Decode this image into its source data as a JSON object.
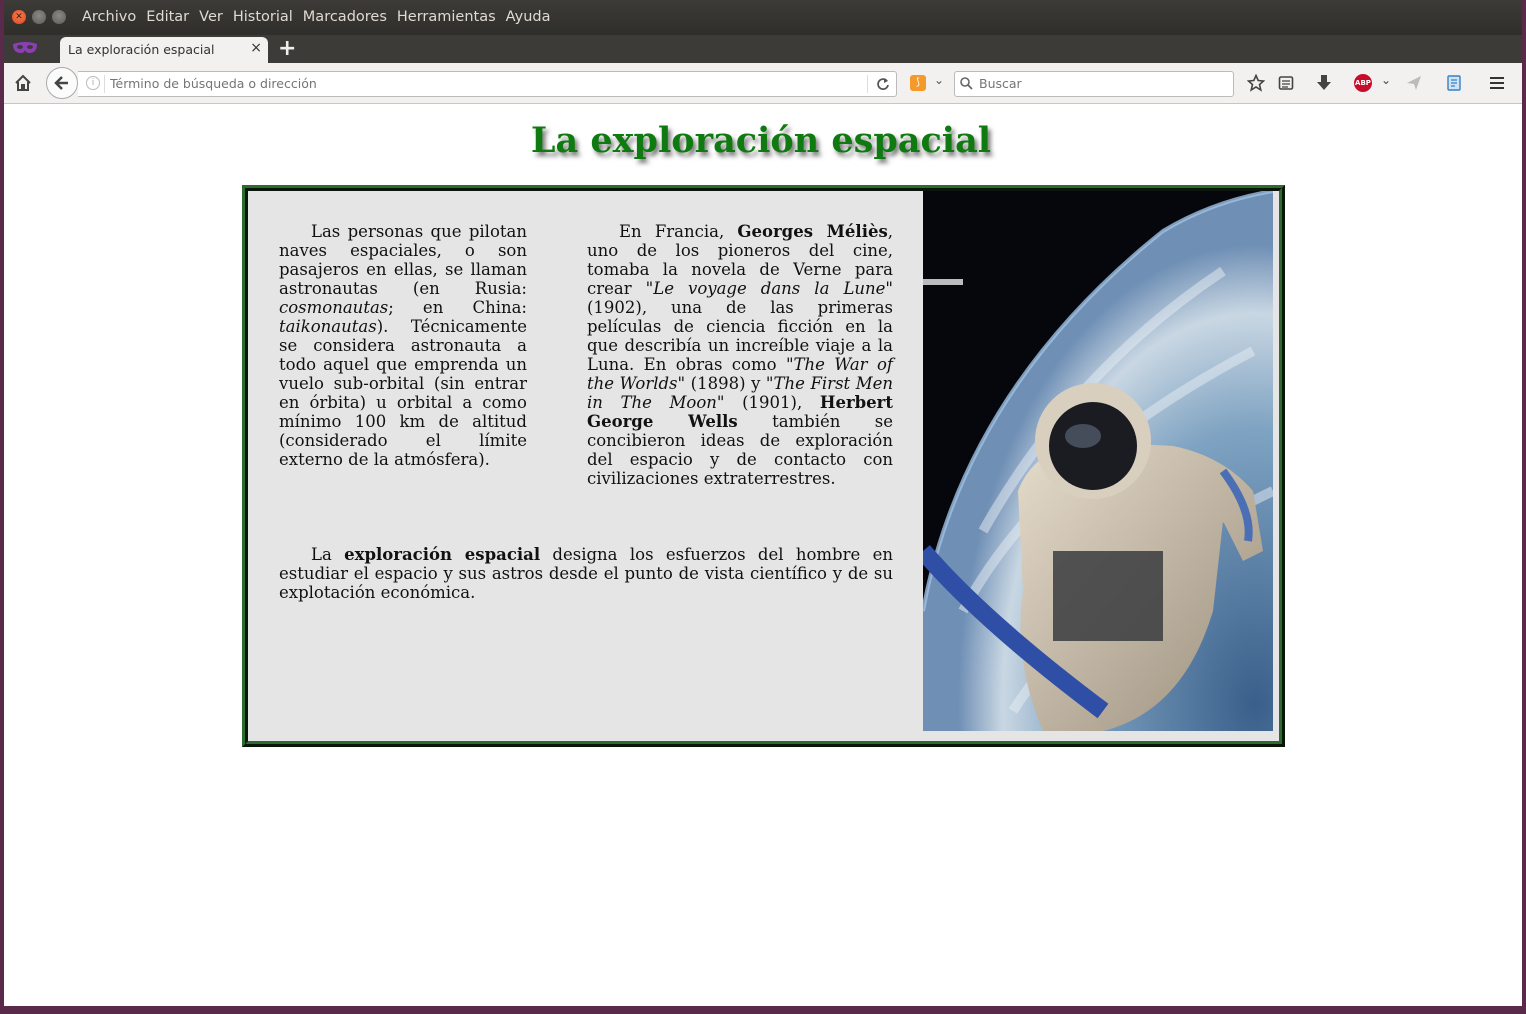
{
  "menubar": {
    "items": [
      "Archivo",
      "Editar",
      "Ver",
      "Historial",
      "Marcadores",
      "Herramientas",
      "Ayuda"
    ]
  },
  "tab": {
    "title": "La exploración espacial",
    "close": "×",
    "new": "+"
  },
  "navbar": {
    "url_placeholder": "Término de búsqueda o dirección",
    "search_placeholder": "Buscar",
    "abp": "ABP"
  },
  "page": {
    "heading": "La exploración espacial",
    "col1": {
      "t1": "Las personas que pilotan naves espaciales, o son pasajeros en ellas, se llaman astronautas (en Rusia: ",
      "i1": "cosmonautas",
      "t2": "; en China: ",
      "i2": "taikonautas",
      "t3": "). Técnicamente se considera astronauta a todo aquel que emprenda un vuelo sub-orbital (sin entrar en órbita) u orbital a como mínimo 100 km de altitud (considerado el límite externo de la atmósfera)."
    },
    "col2": {
      "t1": "En Francia, ",
      "b1": "Georges Méliès",
      "t2": ", uno de los pioneros del cine, tomaba la novela de Verne para crear \"",
      "i1": "Le voyage dans la Lune",
      "t3": "\" (1902), una de las primeras películas de ciencia ficción en la que describía un increíble viaje a la Luna. En obras como \"",
      "i2": "The War of the Worlds",
      "t4": "\" (1898) y \"",
      "i3": "The First Men in The Moon",
      "t5": "\" (1901), ",
      "b2": "Herbert George Wells",
      "t6": " también se concibieron ideas de exploración del espacio y de contacto con civilizaciones extraterrestres."
    },
    "col3": {
      "t1": "La ",
      "b1": "exploración espacial",
      "t2": " designa los esfuerzos del hombre en estudiar el espacio y sus astros desde el punto de vista científico y de su explotación económica."
    }
  },
  "colors": {
    "heading": "#0f7a0f",
    "frame_border": "#2e6b2e",
    "content_bg": "#e5e5e5",
    "titlebar": "#3c3b37"
  }
}
